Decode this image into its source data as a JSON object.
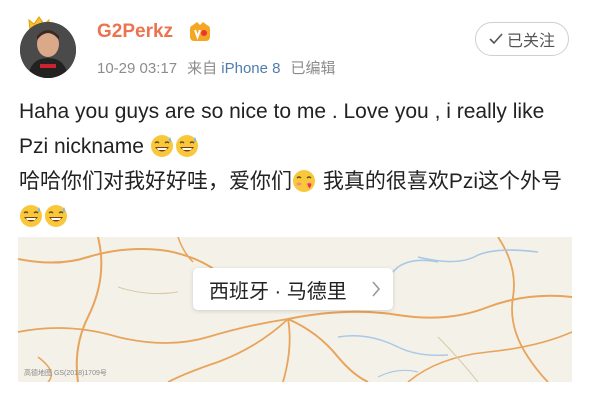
{
  "header": {
    "username": "G2Perkz",
    "date_time": "10-29 03:17",
    "source_prefix": "来自",
    "device": "iPhone 8",
    "edited": "已编辑",
    "follow_label": "已关注"
  },
  "post": {
    "line1": "Haha you guys are so nice to me . Love you , i really like Pzi nickname",
    "line2_a": "哈哈你们对我好好哇，爱你们",
    "line2_b": " 我真的很喜欢Pzi这个外号",
    "emoji_laugh": "laughing-sweat-emoji",
    "emoji_love": "love-emoji"
  },
  "map": {
    "location": "西班牙 · 马德里",
    "credit": "高德地图 GS(2018)1709号"
  },
  "colors": {
    "username": "#eb7350",
    "device_link": "#507daf",
    "road": "#e8a45a",
    "water": "#a9c8e6"
  }
}
